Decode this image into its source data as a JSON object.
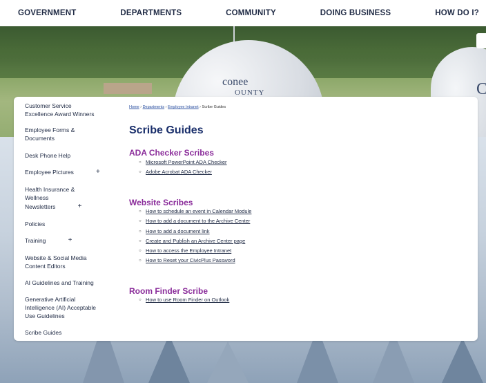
{
  "nav": {
    "items": [
      "GOVERNMENT",
      "DEPARTMENTS",
      "COMMUNITY",
      "DOING BUSINESS",
      "HOW DO I?"
    ]
  },
  "hero": {
    "tank_text_line1": "conee",
    "tank_text_line2": "OUNTY",
    "tank2_text": "C"
  },
  "sidebar": {
    "items": [
      {
        "label": "Customer Service Excellence Award Winners",
        "expandable": false
      },
      {
        "label": "Employee Forms & Documents",
        "expandable": false
      },
      {
        "label": "Desk Phone Help",
        "expandable": false
      },
      {
        "label": "Employee Pictures",
        "expandable": true
      },
      {
        "label": "Health Insurance & Wellness",
        "expandable": false
      },
      {
        "label": "Newsletters",
        "expandable": true
      },
      {
        "label": "Policies",
        "expandable": false
      },
      {
        "label": "Training",
        "expandable": true
      },
      {
        "label": "Website & Social Media Content Editors",
        "expandable": false
      },
      {
        "label": "AI Guidelines and Training",
        "expandable": false
      },
      {
        "label": "Generative Artificial Intelligence (AI) Acceptable Use Guidelines",
        "expandable": false
      },
      {
        "label": "Scribe Guides",
        "expandable": false
      }
    ],
    "plus_symbol": "+"
  },
  "breadcrumb": {
    "items": [
      "Home",
      "Departments",
      "Employee Intranet"
    ],
    "separator": "›",
    "current": "Scribe Guides"
  },
  "main": {
    "title": "Scribe Guides",
    "sections": [
      {
        "title": "ADA Checker Scribes",
        "links": [
          "Microsoft PowerPoint ADA Checker",
          "Adobe Acrobat ADA Checker"
        ]
      },
      {
        "title": "Website Scribes",
        "links": [
          "How to schedule an event in Calendar Module",
          "How to add a document to the Archive Center",
          "How to add a document link",
          "Create and Publish an Archive Center page",
          "How to access the Employee Intranet",
          "How to Reset your CivicPlus Password"
        ]
      },
      {
        "title": "Room Finder Scribe",
        "links": [
          "How to use Room Finder on Outlook"
        ]
      }
    ]
  },
  "colors": {
    "nav_text": "#1f2a44",
    "title": "#1a2f6b",
    "section_title": "#8a2c9a",
    "link": "#1f2a44",
    "breadcrumb_link": "#2a4fa0"
  }
}
